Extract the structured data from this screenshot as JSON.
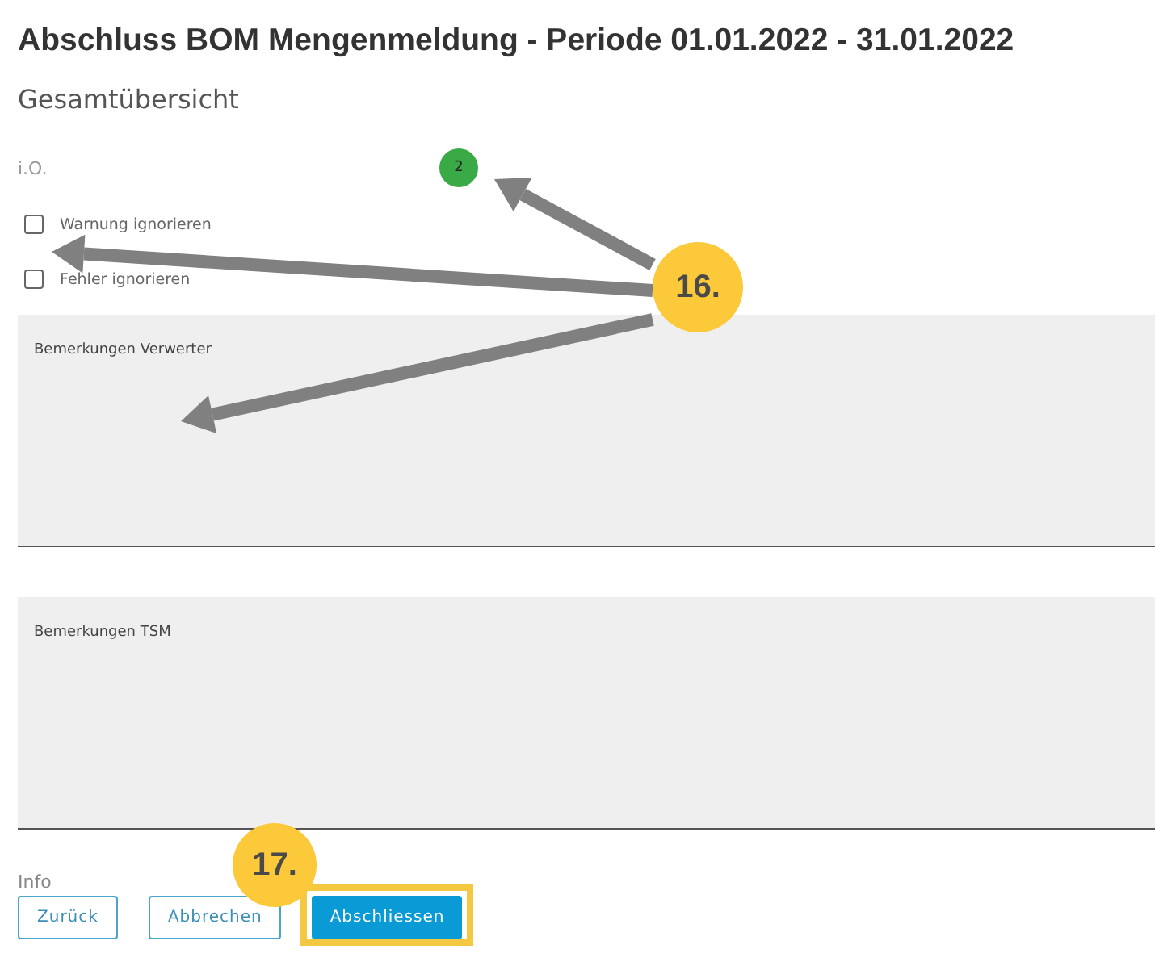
{
  "title": "Abschluss BOM Mengenmeldung - Periode 01.01.2022 - 31.01.2022",
  "subtitle": "Gesamtübersicht",
  "status": {
    "label": "i.O.",
    "count": "2",
    "color": "#3aaa47"
  },
  "checkboxes": [
    {
      "label": "Warnung ignorieren",
      "checked": false
    },
    {
      "label": "Fehler ignorieren",
      "checked": false
    }
  ],
  "remarks": [
    {
      "label": "Bemerkungen Verwerter"
    },
    {
      "label": "Bemerkungen TSM"
    }
  ],
  "info_label": "Info",
  "buttons": [
    {
      "label": "Zurück",
      "kind": "outline",
      "highlighted": false
    },
    {
      "label": "Abbrechen",
      "kind": "outline",
      "highlighted": false
    },
    {
      "label": "Abschliessen",
      "kind": "primary",
      "highlighted": true
    }
  ],
  "annotations": [
    {
      "number": "16."
    },
    {
      "number": "17."
    }
  ]
}
